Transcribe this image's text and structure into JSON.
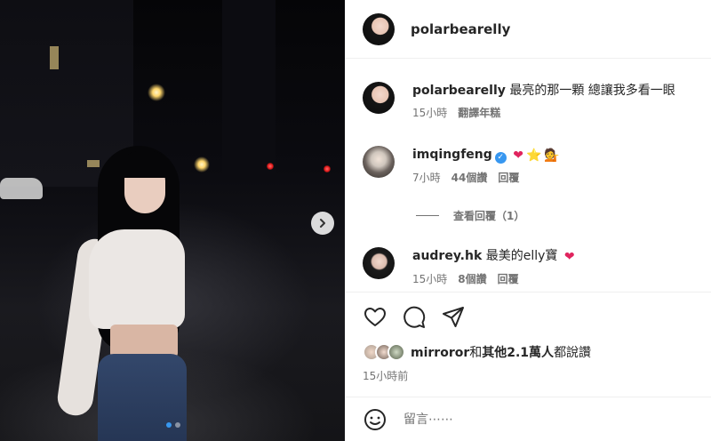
{
  "post": {
    "author": "polarbearelly",
    "photo_next_icon": "chevron-right-icon",
    "carousel": {
      "count": 2,
      "active_index": 0
    }
  },
  "comments": [
    {
      "username": "polarbearelly",
      "text": "最亮的那一顆 總讓我多看一眼",
      "time": "15小時",
      "action": "翻譯年糕",
      "verified": false
    },
    {
      "username": "imqingfeng",
      "text": "",
      "emojis": [
        "❤",
        "⭐",
        "💁"
      ],
      "time": "7小時",
      "likes": "44個讚",
      "reply": "回覆",
      "verified": true
    },
    {
      "username": "audrey.hk",
      "text": "最美的elly寶",
      "emojis": [
        "❤"
      ],
      "time": "15小時",
      "likes": "8個讚",
      "reply": "回覆",
      "verified": false
    }
  ],
  "view_replies": "查看回覆（1）",
  "likes_line": {
    "user": "mirroror",
    "middle": "和",
    "others": "其他2.1萬人",
    "suffix": "都說讚"
  },
  "post_time": "15小時前",
  "comment_input": {
    "placeholder": "留言⋯⋯",
    "value": ""
  },
  "colors": {
    "link_blue": "#3797f0",
    "heart_red": "#e0245e",
    "muted": "#737373"
  }
}
